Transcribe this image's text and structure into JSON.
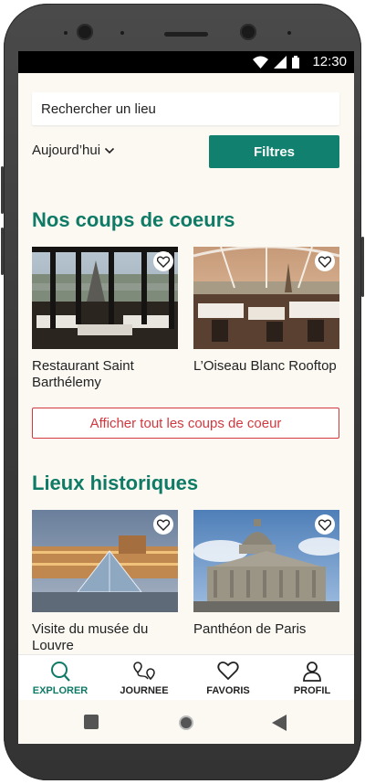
{
  "status": {
    "time": "12:30"
  },
  "search": {
    "placeholder": "Rechercher un lieu"
  },
  "filters": {
    "day_label": "Aujourd’hui",
    "button_label": "Filtres"
  },
  "favorites": {
    "title": "Nos coups de coeurs",
    "items": [
      {
        "name": "Restaurant Saint Barthélemy"
      },
      {
        "name": "L’Oiseau Blanc Rooftop"
      }
    ],
    "show_all_label": "Afficher tout les coups de coeur"
  },
  "historic": {
    "title": "Lieux historiques",
    "items": [
      {
        "name": "Visite du musée du Louvre"
      },
      {
        "name": "Panthéon de Paris"
      }
    ]
  },
  "nav": {
    "items": [
      {
        "label": "EXPLORER",
        "icon": "search-icon",
        "active": true
      },
      {
        "label": "JOURNEE",
        "icon": "route-icon",
        "active": false
      },
      {
        "label": "FAVORIS",
        "icon": "heart-icon",
        "active": false
      },
      {
        "label": "PROFIL",
        "icon": "user-icon",
        "active": false
      }
    ]
  },
  "colors": {
    "accent": "#0f7b66",
    "button": "#12806e",
    "danger": "#d2393f",
    "background": "#fbf9f2"
  }
}
